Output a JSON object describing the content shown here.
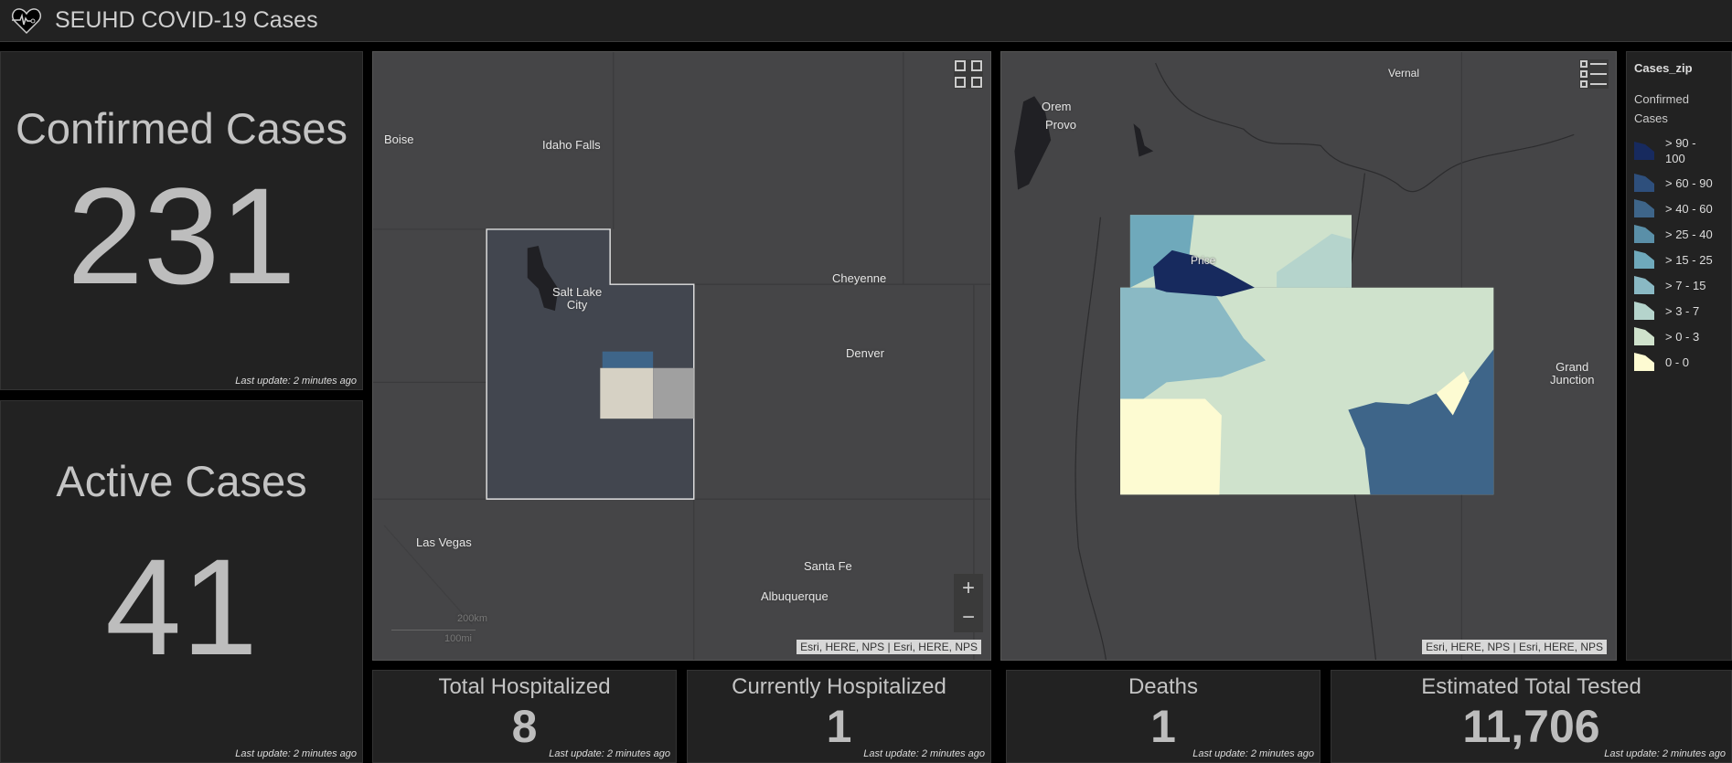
{
  "header": {
    "title": "SEUHD COVID-19 Cases",
    "icon": "heart-pulse-icon"
  },
  "cards": {
    "confirmed": {
      "title": "Confirmed Cases",
      "value": "231",
      "update": "Last update: 2 minutes ago"
    },
    "active": {
      "title": "Active Cases",
      "value": "41",
      "update": "Last update: 2 minutes ago"
    },
    "total_hosp": {
      "title": "Total Hospitalized",
      "value": "8",
      "update": "Last update: 2 minutes ago"
    },
    "current_hosp": {
      "title": "Currently Hospitalized",
      "value": "1",
      "update": "Last update: 2 minutes ago"
    },
    "deaths": {
      "title": "Deaths",
      "value": "1",
      "update": "Last update: 2 minutes ago"
    },
    "tested": {
      "title": "Estimated Total Tested",
      "value": "11,706",
      "update": "Last update: 2 minutes ago"
    }
  },
  "map1": {
    "labels": {
      "boise": "Boise",
      "idaho_falls": "Idaho Falls",
      "slc1": "Salt Lake",
      "slc2": "City",
      "cheyenne": "Cheyenne",
      "denver": "Denver",
      "las_vegas": "Las Vegas",
      "santa_fe": "Santa Fe",
      "albuquerque": "Albuquerque"
    },
    "scale_km": "200km",
    "scale_mi": "100mi",
    "zoom_in": "+",
    "zoom_out": "−",
    "attribution": "Esri, HERE, NPS | Esri, HERE, NPS"
  },
  "map2": {
    "labels": {
      "orem": "Orem",
      "provo": "Provo",
      "vernal": "Vernal",
      "price": "Price",
      "gj1": "Grand",
      "gj2": "Junction"
    },
    "attribution": "Esri, HERE, NPS | Esri, HERE, NPS"
  },
  "legend": {
    "layer": "Cases_zip",
    "field": "Confirmed Cases",
    "items": [
      {
        "label": "> 90 - 100",
        "color": "#172a5e"
      },
      {
        "label": "> 60 - 90",
        "color": "#2e4f7c"
      },
      {
        "label": "> 40 - 60",
        "color": "#3e6589"
      },
      {
        "label": "> 25 - 40",
        "color": "#5a8fa8"
      },
      {
        "label": "> 15 - 25",
        "color": "#6fa9bb"
      },
      {
        "label": "> 7 - 15",
        "color": "#8ab9c4"
      },
      {
        "label": "> 3 - 7",
        "color": "#b5d4cc"
      },
      {
        "label": "> 0 - 3",
        "color": "#cfe2cc"
      },
      {
        "label": "0 - 0",
        "color": "#fdfbd2"
      }
    ]
  }
}
